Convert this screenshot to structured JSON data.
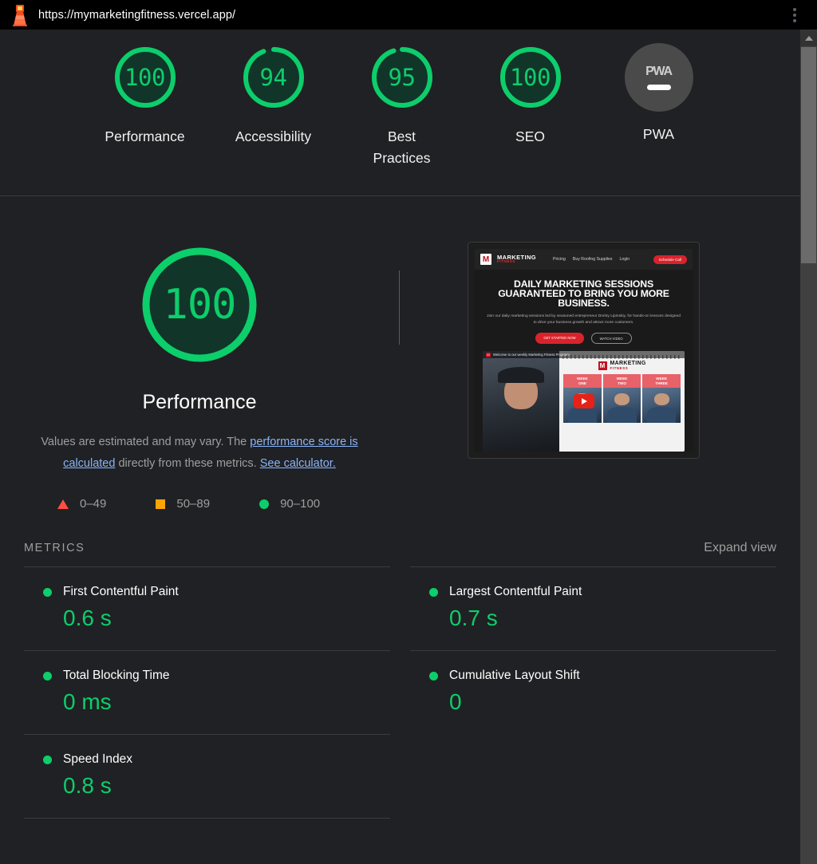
{
  "header": {
    "url": "https://mymarketingfitness.vercel.app/",
    "logo_icon": "lighthouse-icon",
    "menu_icon": "kebab-menu-icon"
  },
  "score_gauges": [
    {
      "value": "100",
      "label": "Performance",
      "pct": 100,
      "color": "#0cce6b"
    },
    {
      "value": "94",
      "label": "Accessibility",
      "pct": 94,
      "color": "#0cce6b"
    },
    {
      "value": "95",
      "label": "Best\nPractices",
      "label_line1": "Best",
      "label_line2": "Practices",
      "pct": 95,
      "color": "#0cce6b"
    },
    {
      "value": "100",
      "label": "SEO",
      "pct": 100,
      "color": "#0cce6b"
    }
  ],
  "pwa": {
    "badge_text": "PWA",
    "label": "PWA",
    "circle_color": "#4a4a4a"
  },
  "category": {
    "score": "100",
    "title": "Performance",
    "score_color": "#0cce6b",
    "description": {
      "part1": "Values are estimated and may vary. The ",
      "link1": "performance score is calculated",
      "part2": " directly from these metrics. ",
      "link2": "See calculator.",
      "link_color": "#8ab4f8"
    }
  },
  "legend": [
    {
      "icon": "triangle-fail-icon",
      "range": "0–49",
      "color": "#ff4e42"
    },
    {
      "icon": "square-average-icon",
      "range": "50–89",
      "color": "#ffa400"
    },
    {
      "icon": "circle-pass-icon",
      "range": "90–100",
      "color": "#0cce6b"
    }
  ],
  "metrics_section": {
    "title": "METRICS",
    "expand_label": "Expand view",
    "items": [
      {
        "name": "First Contentful Paint",
        "value": "0.6 s",
        "status": "pass"
      },
      {
        "name": "Largest Contentful Paint",
        "value": "0.7 s",
        "status": "pass"
      },
      {
        "name": "Total Blocking Time",
        "value": "0 ms",
        "status": "pass"
      },
      {
        "name": "Cumulative Layout Shift",
        "value": "0",
        "status": "pass"
      },
      {
        "name": "Speed Index",
        "value": "0.8 s",
        "status": "pass"
      }
    ]
  },
  "screenshot_thumbnail": {
    "nav": {
      "logo_letter": "M",
      "brand_line1": "MARKETING",
      "brand_line2": "FITNESS",
      "links": [
        "Pricing",
        "Buy Roofing Supplies",
        "Login"
      ],
      "cta": "Schedule Call"
    },
    "hero": {
      "heading": "DAILY MARKETING SESSIONS GUARANTEED TO BRING YOU MORE BUSINESS.",
      "subheading": "Join our daily marketing sessions led by seasoned entrepreneur Dmitry Lipinskiy, for hands-on lessons designed to drive your business growth and attract more customers.",
      "primary_button": "GET STARTED NOW",
      "secondary_button": "WATCH VIDEO"
    },
    "video": {
      "badge_letter": "M",
      "title": "Welcome to our weekly Marketing Fitness Program!",
      "play_icon": "youtube-play-icon"
    },
    "calendar": {
      "logo_letter": "M",
      "title_line1": "MARKETING",
      "title_line2": "FITNESS",
      "weeks": [
        {
          "line1": "WEEK",
          "line2": "ONE"
        },
        {
          "line1": "WEEK",
          "line2": "TWO"
        },
        {
          "line1": "WEEK",
          "line2": "THREE"
        }
      ]
    }
  },
  "scrollbar": {
    "up_arrow_icon": "scroll-up-arrow-icon"
  }
}
